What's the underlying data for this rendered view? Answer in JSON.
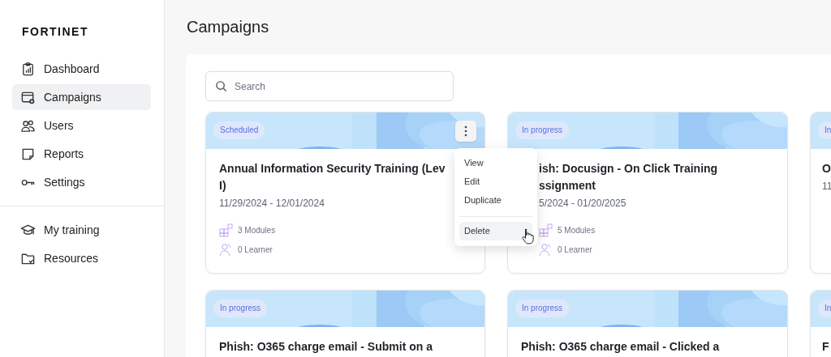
{
  "logo": "FORTINET",
  "sidebar": {
    "groups": [
      {
        "items": [
          {
            "label": "Dashboard",
            "selected": false
          },
          {
            "label": "Campaigns",
            "selected": true
          },
          {
            "label": "Users",
            "selected": false
          },
          {
            "label": "Reports",
            "selected": false
          },
          {
            "label": "Settings",
            "selected": false
          }
        ]
      },
      {
        "items": [
          {
            "label": "My training",
            "selected": false
          },
          {
            "label": "Resources",
            "selected": false
          }
        ]
      }
    ]
  },
  "page_title": "Campaigns",
  "search": {
    "placeholder": "Search"
  },
  "cards": [
    {
      "status": "Scheduled",
      "title_lines": [
        "Annual Information Security Training (Lev",
        "I)"
      ],
      "dates": "11/29/2024 - 12/01/2024",
      "modules": "3 Modules",
      "learners": "0 Learner",
      "menu_open": true
    },
    {
      "status": "In progress",
      "title_lines": [
        "ish: Docusign - On Click Training",
        "ssignment"
      ],
      "dates": "5/2024 - 01/20/2025",
      "modules": "5 Modules",
      "learners": "0 Learner",
      "menu_open": false
    },
    {
      "status": "In",
      "title_lines": [
        "O"
      ],
      "dates": "11",
      "menu_open": false
    },
    {
      "status": "In progress",
      "title_lines": [
        "Phish: O365 charge email - Submit on a"
      ],
      "menu_open": false
    },
    {
      "status": "In progress",
      "title_lines": [
        "Phish: O365 charge email - Clicked a"
      ],
      "menu_open": false
    },
    {
      "status": "In",
      "title_lines": [
        "F"
      ],
      "menu_open": false
    }
  ],
  "card_menu": {
    "items": [
      {
        "label": "View",
        "highlighted": false
      },
      {
        "label": "Edit",
        "highlighted": false
      },
      {
        "label": "Duplicate",
        "highlighted": false
      },
      {
        "label": "Delete",
        "highlighted": true,
        "divider_before": true
      }
    ]
  }
}
